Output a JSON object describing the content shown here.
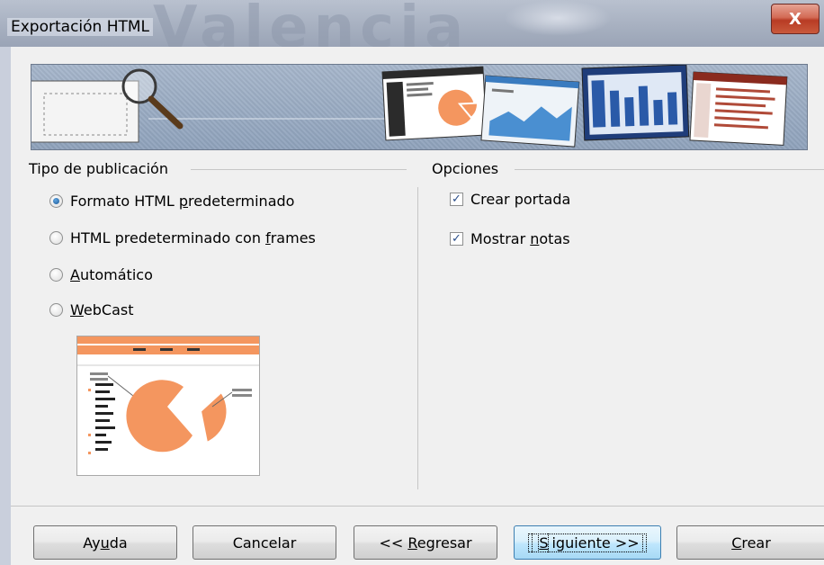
{
  "window": {
    "title": "Exportación HTML",
    "background_text": "Valencia",
    "close_label": "X"
  },
  "publication_type": {
    "heading": "Tipo de publicación",
    "options": [
      {
        "pre": "Formato HTML ",
        "key": "p",
        "post": "redeterminado",
        "selected": true
      },
      {
        "pre": "HTML predeterminado con ",
        "key": "f",
        "post": "rames",
        "selected": false
      },
      {
        "pre": "",
        "key": "A",
        "post": "utomático",
        "selected": false
      },
      {
        "pre": "",
        "key": "W",
        "post": "ebCast",
        "selected": false
      }
    ]
  },
  "options": {
    "heading": "Opciones",
    "items": [
      {
        "pre": "Crear portada",
        "key": "",
        "post": "",
        "checked": true
      },
      {
        "pre": "Mostrar ",
        "key": "n",
        "post": "otas",
        "checked": true
      }
    ]
  },
  "buttons": [
    {
      "pre": "Ay",
      "key": "u",
      "post": "da"
    },
    {
      "pre": "Cancelar",
      "key": "",
      "post": ""
    },
    {
      "pre": "<< ",
      "key": "R",
      "post": "egresar"
    },
    {
      "pre": "",
      "key": "S",
      "post": "iguiente >>"
    },
    {
      "pre": "",
      "key": "C",
      "post": "rear"
    }
  ],
  "colors": {
    "accent_orange": "#f4965f",
    "checkmark": "#2a4e8a",
    "default_button_border": "#3c7fb1"
  },
  "icons": [
    "magnifier-icon",
    "radio-icon",
    "checkbox-icon",
    "pie-chart-icon"
  ]
}
